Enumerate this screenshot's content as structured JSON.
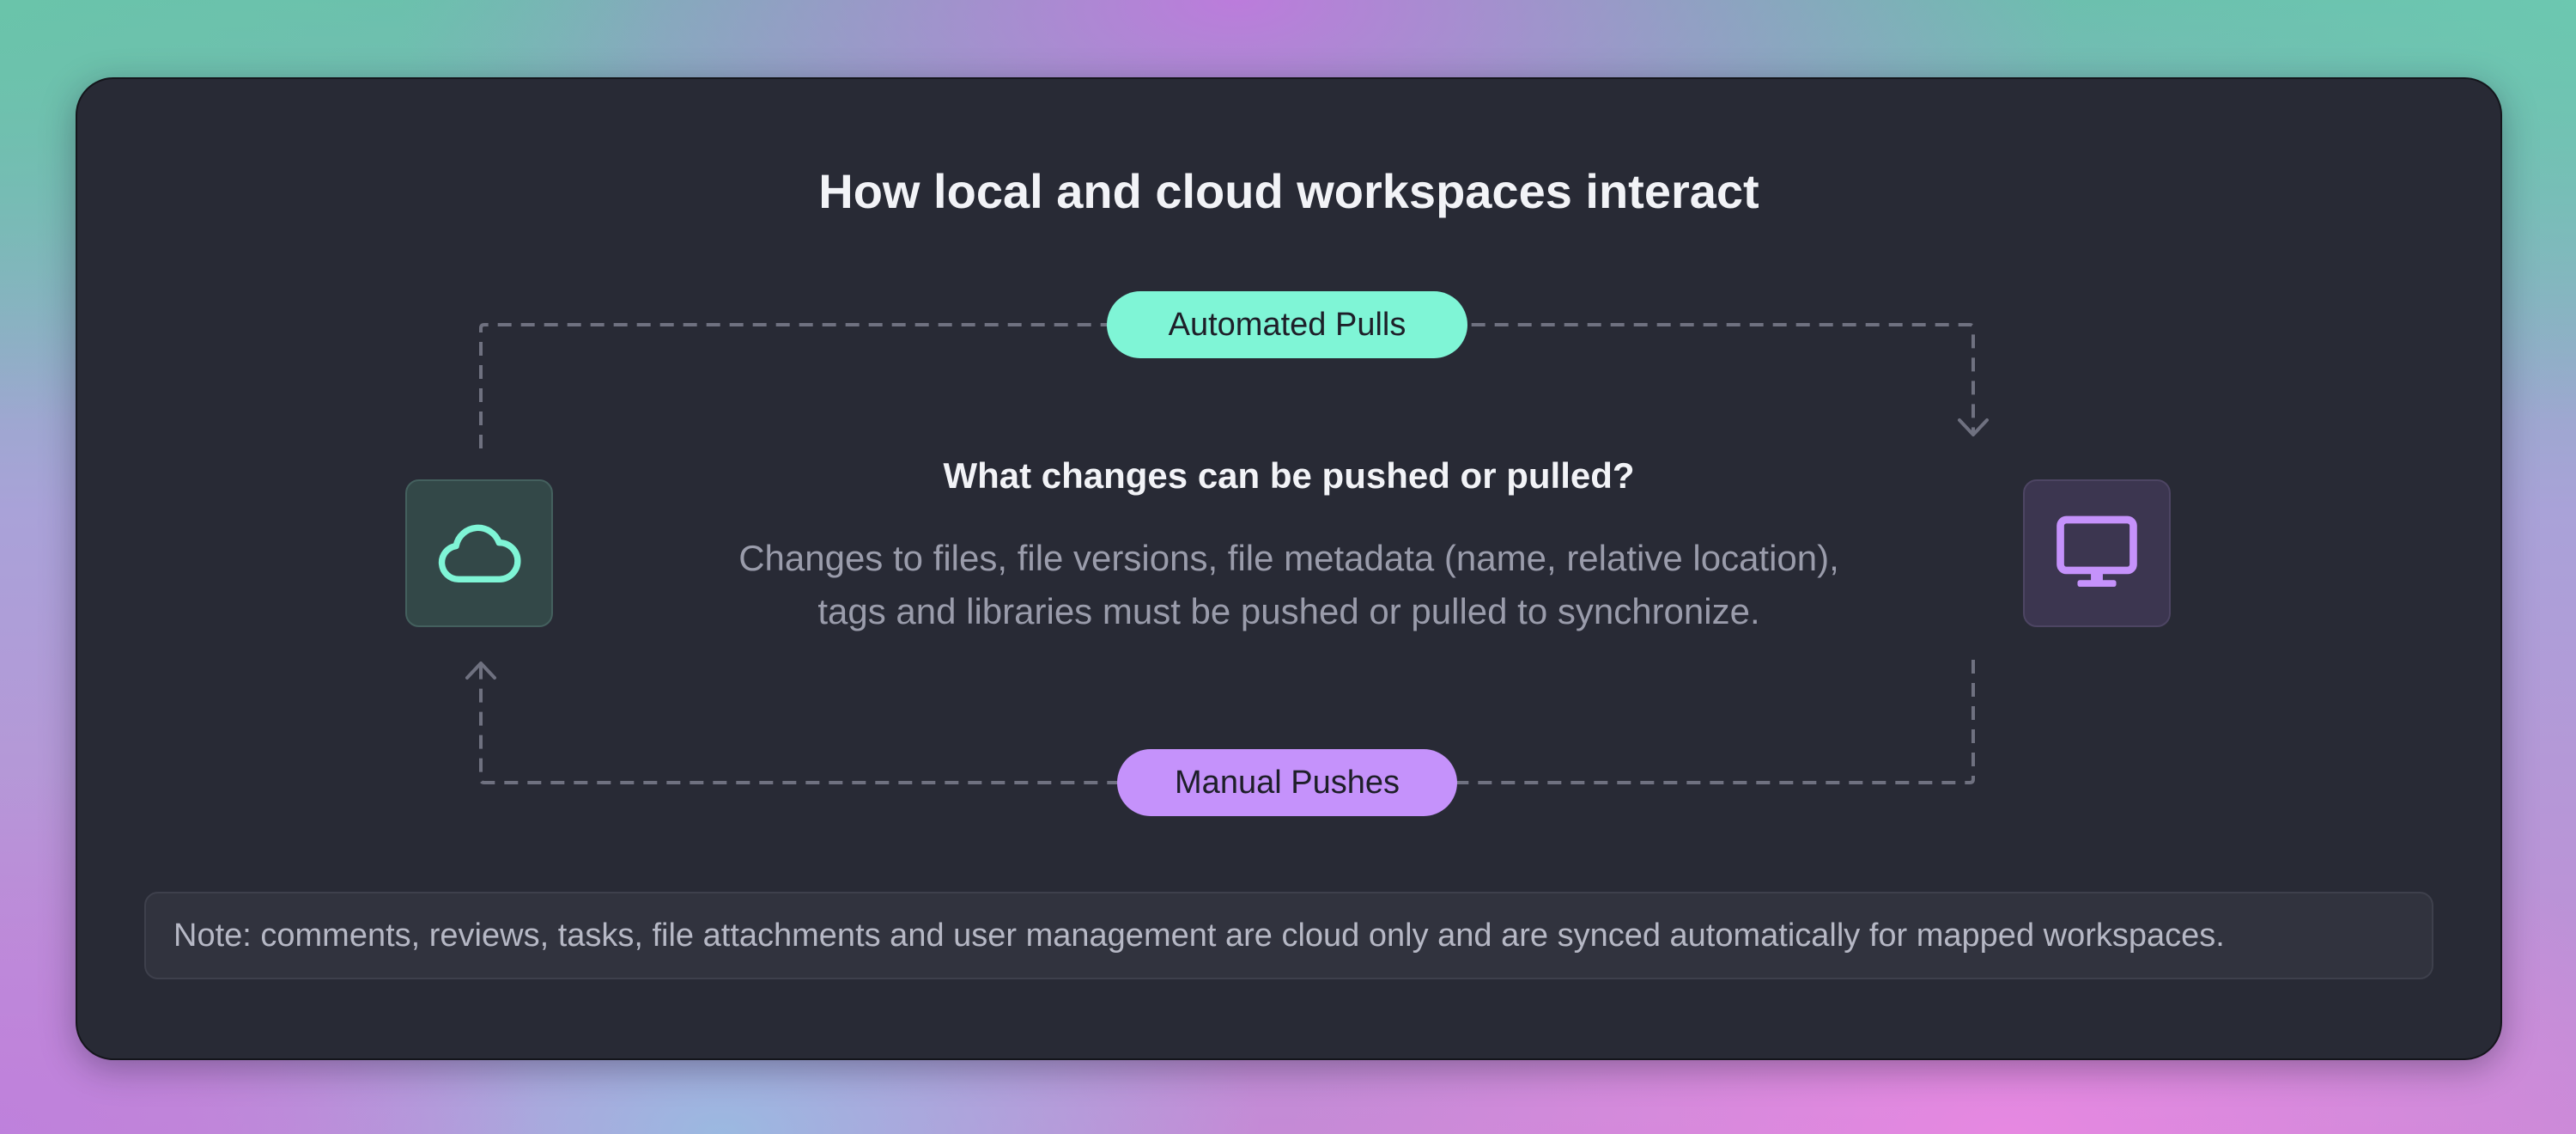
{
  "diagram": {
    "title": "How local and cloud workspaces interact",
    "top_label": "Automated Pulls",
    "bottom_label": "Manual Pushes",
    "question": "What changes can be pushed or pulled?",
    "description_lines": [
      "Changes to files, file versions, file metadata (name, relative location),",
      "tags and libraries must be pushed or pulled to synchronize."
    ],
    "note": "Note: comments, reviews, tasks, file attachments and user management are cloud only and are synced automatically for mapped workspaces.",
    "nodes": {
      "left_icon": "cloud-icon",
      "right_icon": "monitor-icon"
    },
    "colors": {
      "pull_accent": "#7ff5d6",
      "push_accent": "#c592fb",
      "card_background": "#282a35",
      "connector": "#6f7180"
    }
  }
}
